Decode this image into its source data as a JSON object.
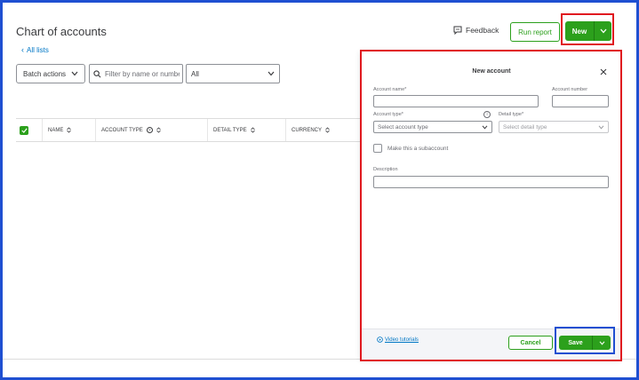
{
  "page": {
    "title": "Chart of accounts",
    "back_link": "All lists"
  },
  "toolbar": {
    "batch_actions": "Batch actions",
    "filter_placeholder": "Filter by name or number",
    "type_filter_value": "All",
    "feedback": "Feedback",
    "run_report": "Run report",
    "new_label": "New"
  },
  "table": {
    "columns": [
      "NAME",
      "ACCOUNT TYPE",
      "DETAIL TYPE",
      "CURRENCY"
    ]
  },
  "drawer": {
    "title": "New account",
    "account_name_label": "Account name*",
    "account_number_label": "Account number",
    "account_type_label": "Account type*",
    "account_type_placeholder": "Select account type",
    "detail_type_label": "Detail type*",
    "detail_type_placeholder": "Select detail type",
    "subaccount_label": "Make this a subaccount",
    "description_label": "Description",
    "video_tutorials": "Video tutorials",
    "cancel": "Cancel",
    "save": "Save"
  },
  "colors": {
    "primary_green": "#2ca01c",
    "link_blue": "#0077c5",
    "highlight_red": "#e0191f",
    "highlight_blue": "#1f4fd1"
  },
  "icons": [
    "chevron-left-icon",
    "chevron-down-icon",
    "search-icon",
    "feedback-icon",
    "sort-icon",
    "info-icon",
    "close-icon",
    "play-circle-icon",
    "check-icon"
  ]
}
